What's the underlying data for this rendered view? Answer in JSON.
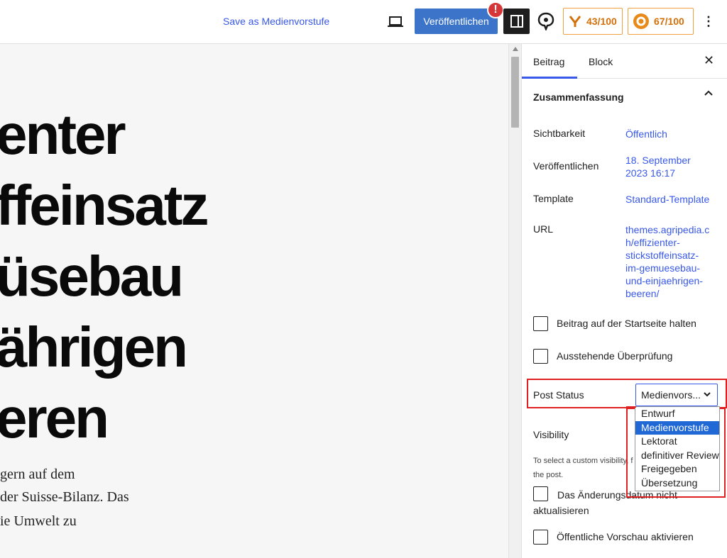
{
  "topbar": {
    "save_draft": "Save as Medienvorstufe",
    "publish": "Veröffentlichen",
    "alert": "!",
    "score1": "43/100",
    "score2": "67/100",
    "more": "⋮"
  },
  "editor": {
    "headline_lines": [
      "enter",
      "ffeinsatz",
      "üsebau",
      "ährigen",
      "eren"
    ],
    "body_lines": [
      "gern auf dem",
      "der Suisse-Bilanz. Das",
      "ie Umwelt zu"
    ]
  },
  "sidebar": {
    "tab_post": "Beitrag",
    "tab_block": "Block",
    "close": "✕",
    "panel_title": "Zusammenfassung",
    "rows": {
      "visibility_label": "Sichtbarkeit",
      "visibility_value": "Öffentlich",
      "publish_label": "Veröffentlichen",
      "publish_value_1": "18. September",
      "publish_value_2": "2023 16:17",
      "template_label": "Template",
      "template_value": "Standard-Template",
      "url_label": "URL",
      "url_lines": [
        "themes.agripedia.c",
        "h/effizienter-",
        "stickstoffeinsatz-",
        "im-gemuesebau-",
        "und-einjaehrigen-",
        "beeren/"
      ]
    },
    "sticky": "Beitrag auf der Startseite halten",
    "pending": "Ausstehende Überprüfung",
    "post_status_label": "Post Status",
    "post_status_value": "Medienvors...",
    "visibility2_label": "Visibility",
    "custom_visibility_text": "To select a custom visibility, f the post.",
    "no_update_line1": "Das Änderungsdatum nicht",
    "no_update_line2": "aktualisieren",
    "public_preview": "Öffentliche Vorschau aktivieren"
  },
  "dropdown": {
    "options": [
      "Entwurf",
      "Medienvorstufe",
      "Lektorat",
      "definitiver Review",
      "Freigegeben",
      "Übersetzung"
    ],
    "selected": "Medienvorstufe"
  },
  "colors": {
    "accent": "#3858e9",
    "publish_bg": "#3b74c9",
    "highlight": "#e02020",
    "score": "#d4700a"
  }
}
